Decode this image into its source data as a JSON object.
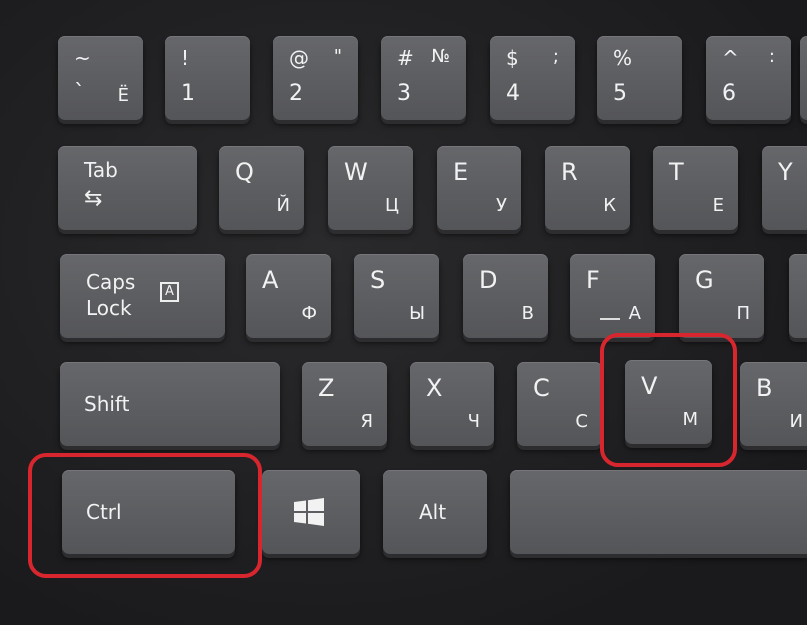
{
  "row1": [
    {
      "top": "~",
      "bottom": "`",
      "ru": "Ё"
    },
    {
      "top": "!",
      "bottom": "1"
    },
    {
      "top": "@",
      "top_right": "\"",
      "bottom": "2"
    },
    {
      "top": "#",
      "top_right": "№",
      "bottom": "3"
    },
    {
      "top": "$",
      "top_right": ";",
      "bottom": "4"
    },
    {
      "top": "%",
      "bottom": "5"
    },
    {
      "top": "^",
      "top_right": ":",
      "bottom": "6"
    }
  ],
  "row2": {
    "tab": "Tab",
    "tab_icon": "tab-arrows-icon",
    "keys": [
      {
        "lat": "Q",
        "ru": "Й"
      },
      {
        "lat": "W",
        "ru": "Ц"
      },
      {
        "lat": "E",
        "ru": "У"
      },
      {
        "lat": "R",
        "ru": "К"
      },
      {
        "lat": "T",
        "ru": "Е"
      },
      {
        "lat": "Y",
        "ru": ""
      }
    ]
  },
  "row3": {
    "caps_line1": "Caps",
    "caps_line2": "Lock",
    "caps_icon": "caps-lock-indicator-icon",
    "keys": [
      {
        "lat": "A",
        "ru": "Ф"
      },
      {
        "lat": "S",
        "ru": "Ы"
      },
      {
        "lat": "D",
        "ru": "В"
      },
      {
        "lat": "F",
        "ru": "А"
      },
      {
        "lat": "G",
        "ru": "П"
      }
    ]
  },
  "row4": {
    "shift": "Shift",
    "keys": [
      {
        "lat": "Z",
        "ru": "Я"
      },
      {
        "lat": "X",
        "ru": "Ч"
      },
      {
        "lat": "C",
        "ru": "С"
      },
      {
        "lat": "V",
        "ru": "М"
      },
      {
        "lat": "B",
        "ru": "И"
      }
    ]
  },
  "row5": {
    "ctrl": "Ctrl",
    "win_icon": "windows-logo-icon",
    "alt": "Alt"
  },
  "highlight_color": "#d8262e",
  "highlighted_keys": [
    "Ctrl",
    "V"
  ]
}
